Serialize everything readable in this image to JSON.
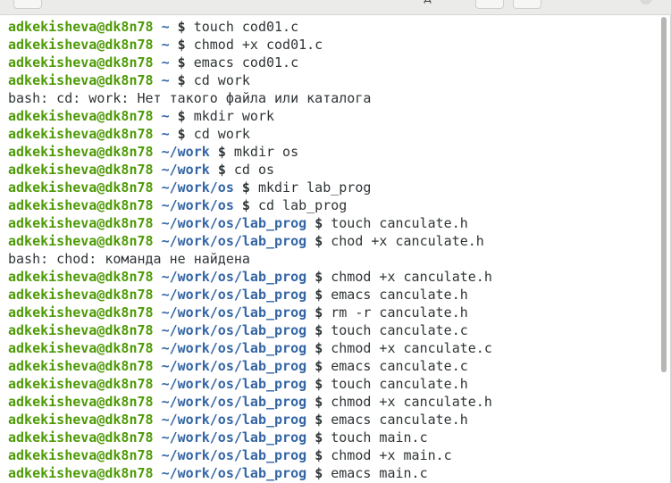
{
  "window": {
    "titlebar_fragment": "д"
  },
  "terminal": {
    "user_host": "adkekisheva@dk8n78",
    "lines": [
      {
        "type": "cmd",
        "path": "~",
        "command": "touch cod01.c"
      },
      {
        "type": "cmd",
        "path": "~",
        "command": "chmod +x cod01.c"
      },
      {
        "type": "cmd",
        "path": "~",
        "command": "emacs cod01.c"
      },
      {
        "type": "cmd",
        "path": "~",
        "command": "cd work"
      },
      {
        "type": "out",
        "text": "bash: cd: work: Нет такого файла или каталога"
      },
      {
        "type": "cmd",
        "path": "~",
        "command": "mkdir work"
      },
      {
        "type": "cmd",
        "path": "~",
        "command": "cd work"
      },
      {
        "type": "cmd",
        "path": "~/work",
        "command": "mkdir os"
      },
      {
        "type": "cmd",
        "path": "~/work",
        "command": "cd os"
      },
      {
        "type": "cmd",
        "path": "~/work/os",
        "command": "mkdir lab_prog"
      },
      {
        "type": "cmd",
        "path": "~/work/os",
        "command": "cd lab_prog"
      },
      {
        "type": "cmd",
        "path": "~/work/os/lab_prog",
        "command": "touch canculate.h"
      },
      {
        "type": "cmd",
        "path": "~/work/os/lab_prog",
        "command": "chod +x canculate.h"
      },
      {
        "type": "out",
        "text": "bash: chod: команда не найдена"
      },
      {
        "type": "cmd",
        "path": "~/work/os/lab_prog",
        "command": "chmod +x canculate.h"
      },
      {
        "type": "cmd",
        "path": "~/work/os/lab_prog",
        "command": "emacs canculate.h"
      },
      {
        "type": "cmd",
        "path": "~/work/os/lab_prog",
        "command": "rm -r canculate.h"
      },
      {
        "type": "cmd",
        "path": "~/work/os/lab_prog",
        "command": "touch canculate.c"
      },
      {
        "type": "cmd",
        "path": "~/work/os/lab_prog",
        "command": "chmod +x canculate.c"
      },
      {
        "type": "cmd",
        "path": "~/work/os/lab_prog",
        "command": "emacs canculate.c"
      },
      {
        "type": "cmd",
        "path": "~/work/os/lab_prog",
        "command": "touch canculate.h"
      },
      {
        "type": "cmd",
        "path": "~/work/os/lab_prog",
        "command": "chmod +x canculate.h"
      },
      {
        "type": "cmd",
        "path": "~/work/os/lab_prog",
        "command": "emacs canculate.h"
      },
      {
        "type": "cmd",
        "path": "~/work/os/lab_prog",
        "command": "touch main.c"
      },
      {
        "type": "cmd",
        "path": "~/work/os/lab_prog",
        "command": "chmod +x main.c"
      },
      {
        "type": "cmd",
        "path": "~/work/os/lab_prog",
        "command": "emacs main.c"
      }
    ],
    "prompt_symbol": "$",
    "colors": {
      "user": "#4e9a06",
      "path": "#3465a4",
      "text": "#2e3436",
      "background": "#ffffff"
    }
  }
}
